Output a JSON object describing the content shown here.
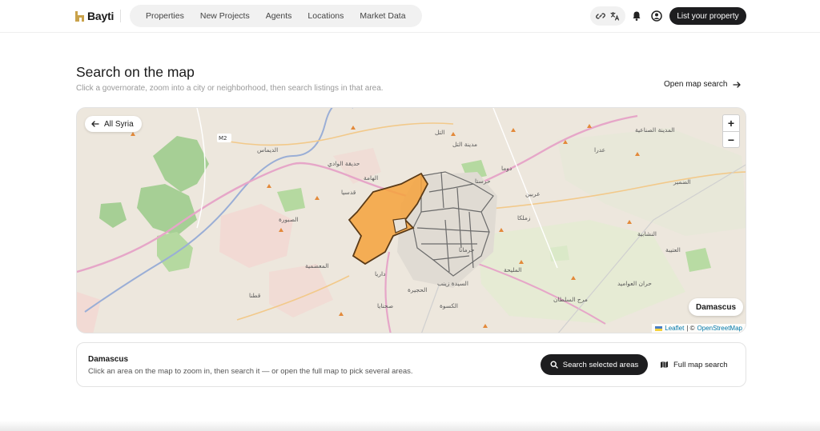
{
  "header": {
    "logo_text": "Bayti",
    "nav": [
      "Properties",
      "New Projects",
      "Agents",
      "Locations",
      "Market Data"
    ],
    "list_property_label": "List your property",
    "icons": [
      "link-icon",
      "translate-icon",
      "bell-icon",
      "user-icon"
    ]
  },
  "section": {
    "title": "Search on the map",
    "subtitle": "Click a governorate, zoom into a city or neighborhood, then search listings in that area.",
    "open_map_label": "Open map search"
  },
  "map": {
    "back_label": "All Syria",
    "zoom_in": "+",
    "zoom_out": "−",
    "selected_area": "Damascus",
    "attribution_leaflet": "Leaflet",
    "attribution_sep": "| ©",
    "attribution_osm": "OpenStreetMap",
    "place_labels": [
      "M2",
      "الديماس",
      "الصبورة",
      "حديقة الوادي",
      "الهامة",
      "قدسيا",
      "التل",
      "دوما",
      "حرستا",
      "مدينة التل",
      "عدرا",
      "المدينة الصناعية",
      "داريا",
      "صحنايا",
      "السيدة زينب",
      "الحجيرة",
      "جرمانا",
      "المليحة",
      "قطنا",
      "الكسوة",
      "العتيبة",
      "مرج السلطان",
      "عربين",
      "زملكا",
      "النشابية",
      "حران العواميد",
      "الضمير",
      "المعضمية"
    ],
    "colors": {
      "selected_fill": "#f4a23c",
      "selected_stroke": "#5a3a17",
      "boundary_stroke": "#6b6b6b"
    }
  },
  "panel": {
    "title": "Damascus",
    "subtitle": "Click an area on the map to zoom in, then search it — or open the full map to pick several areas.",
    "search_label": "Search selected areas",
    "full_map_label": "Full map search"
  }
}
